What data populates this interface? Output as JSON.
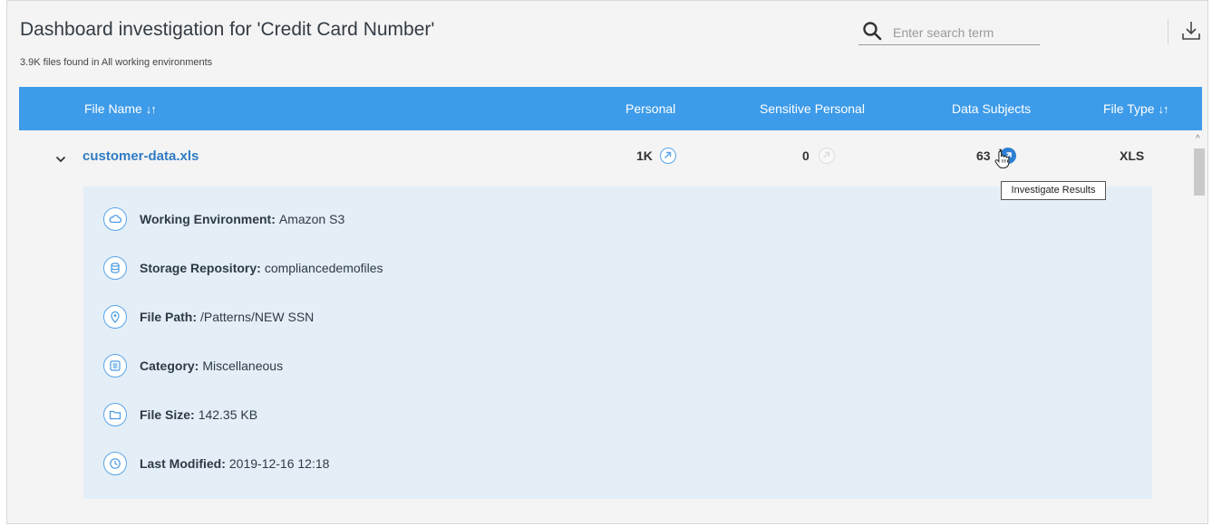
{
  "header": {
    "title": "Dashboard investigation for  'Credit Card Number'",
    "subtitle": "3.9K files found in All working environments"
  },
  "search": {
    "placeholder": "Enter search term",
    "value": ""
  },
  "table": {
    "columns": {
      "file_name": "File Name",
      "personal": "Personal",
      "sensitive_personal": "Sensitive Personal",
      "data_subjects": "Data Subjects",
      "file_type": "File Type"
    },
    "sort_glyph": "↓↑"
  },
  "row": {
    "file_name": "customer-data.xls",
    "personal": "1K",
    "sensitive_personal": "0",
    "data_subjects": "63",
    "file_type": "XLS"
  },
  "tooltip": "Investigate Results",
  "details": [
    {
      "label": "Working Environment:",
      "value": "Amazon S3",
      "icon": "cloud-icon"
    },
    {
      "label": "Storage Repository:",
      "value": "compliancedemofiles",
      "icon": "database-icon"
    },
    {
      "label": "File Path:",
      "value": "/Patterns/NEW SSN",
      "icon": "location-pin-icon"
    },
    {
      "label": "Category:",
      "value": "Miscellaneous",
      "icon": "list-icon"
    },
    {
      "label": "File Size:",
      "value": "142.35 KB",
      "icon": "folder-icon"
    },
    {
      "label": "Last Modified:",
      "value": "2019-12-16 12:18",
      "icon": "clock-icon"
    }
  ],
  "colors": {
    "header_bar": "#3d9be9",
    "link": "#2f7cc4",
    "details_bg": "#e4eef6",
    "accent": "#2e7fd0"
  }
}
